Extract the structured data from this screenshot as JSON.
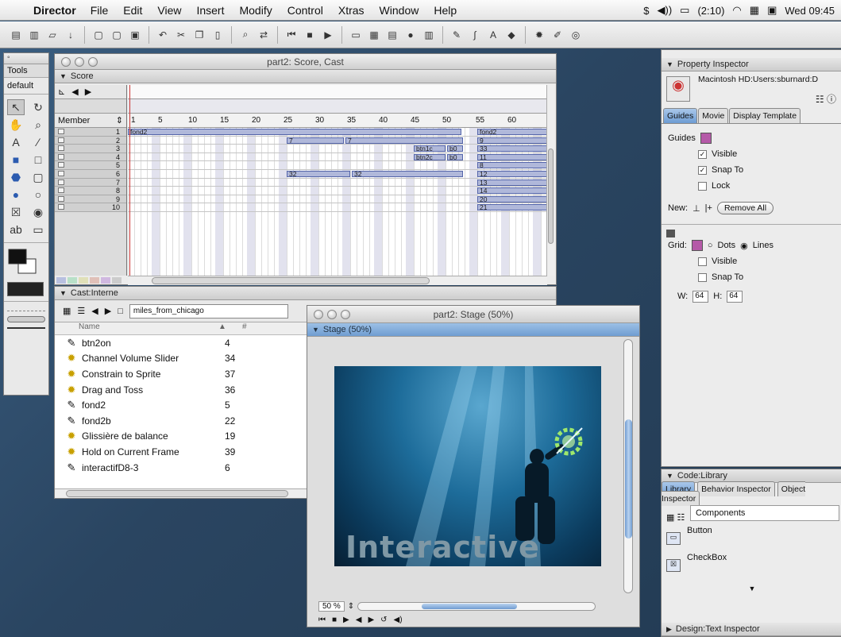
{
  "menubar": {
    "app": "Director",
    "items": [
      "File",
      "Edit",
      "View",
      "Insert",
      "Modify",
      "Control",
      "Xtras",
      "Window",
      "Help"
    ],
    "battery": "(2:10)",
    "clock": "Wed 09:45"
  },
  "tools_palette": {
    "title": "Tools",
    "mode": "default"
  },
  "score_window": {
    "title": "part2: Score, Cast",
    "section": "Score",
    "member_label": "Member",
    "frame_numbers": [
      "1",
      "5",
      "10",
      "15",
      "20",
      "25",
      "30",
      "35",
      "40",
      "45",
      "50",
      "55",
      "60"
    ],
    "channels": [
      "1",
      "2",
      "3",
      "4",
      "5",
      "6",
      "7",
      "8",
      "9",
      "10"
    ],
    "sprites_left": {
      "ch1": "fond2",
      "ch2a": "7",
      "ch2b": "7",
      "ch3": "btn1c",
      "ch3b": "b0",
      "ch4": "btn2c",
      "ch4b": "b0",
      "ch6a": "32",
      "ch6b": "32"
    },
    "sprites_right": [
      "fond2",
      "9",
      "33",
      "11",
      "8",
      "12",
      "13",
      "14",
      "20",
      "21"
    ]
  },
  "cast_window": {
    "section": "Cast:Interne",
    "cast_name": "miles_from_chicago",
    "col_name": "Name",
    "col_num": "#",
    "members": [
      {
        "icon": "brush",
        "name": "btn2on",
        "num": "4"
      },
      {
        "icon": "behavior",
        "name": "Channel Volume Slider",
        "num": "34"
      },
      {
        "icon": "behavior",
        "name": "Constrain to Sprite",
        "num": "37"
      },
      {
        "icon": "behavior",
        "name": "Drag and Toss",
        "num": "36"
      },
      {
        "icon": "brush",
        "name": "fond2",
        "num": "5"
      },
      {
        "icon": "brush",
        "name": "fond2b",
        "num": "22"
      },
      {
        "icon": "behavior",
        "name": "Glissière de balance",
        "num": "19"
      },
      {
        "icon": "behavior",
        "name": "Hold on Current Frame",
        "num": "39"
      },
      {
        "icon": "brush",
        "name": "interactifD8-3",
        "num": "6"
      }
    ]
  },
  "stage_window": {
    "title": "part2: Stage (50%)",
    "section": "Stage (50%)",
    "canvas_text": "Interactive",
    "zoom": "50 %"
  },
  "property_inspector": {
    "section": "Property Inspector",
    "path": "Macintosh HD:Users:sburnard:D",
    "tabs": [
      "Guides",
      "Movie",
      "Display Template"
    ],
    "guides_label": "Guides",
    "visible_label": "Visible",
    "snap_label": "Snap To",
    "lock_label": "Lock",
    "new_label": "New:",
    "remove_all": "Remove All",
    "grid_label": "Grid:",
    "dots_label": "Dots",
    "lines_label": "Lines",
    "grid_visible": "Visible",
    "grid_snap": "Snap To",
    "w_label": "W:",
    "w_value": "64",
    "h_label": "H:",
    "h_value": "64"
  },
  "code_library": {
    "section": "Code:Library",
    "tabs": [
      "Library",
      "Behavior Inspector",
      "Object Inspector"
    ],
    "category": "Components",
    "items": [
      "Button",
      "CheckBox"
    ],
    "footer": "Design:Text Inspector"
  }
}
